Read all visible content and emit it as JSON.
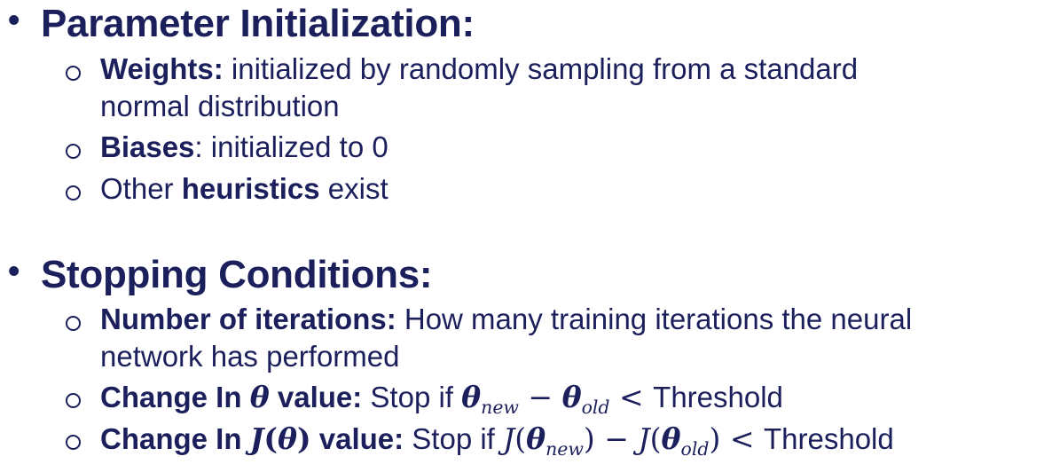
{
  "sections": [
    {
      "heading": "Parameter Initialization:",
      "items": [
        {
          "bold": "Weights:",
          "text": " initialized by randomly sampling from a standard",
          "continuation": "normal distribution"
        },
        {
          "bold": "Biases",
          "text": ": initialized to 0"
        },
        {
          "pre": "Other ",
          "bold": "heuristics",
          "text": " exist"
        }
      ]
    },
    {
      "heading": "Stopping Conditions:",
      "items": [
        {
          "bold": "Number of iterations:",
          "text": " How many training iterations the neural",
          "continuation": "network has performed"
        },
        {
          "bold_pre": "Change In ",
          "bold_symbol": "θ",
          "bold_post": " value:",
          "text": " Stop if ",
          "math": {
            "theta": "θ",
            "new": "new",
            "minus": " − ",
            "old": "old",
            "lt": " < ",
            "threshold": "Threshold"
          }
        },
        {
          "bold_pre": "Change In ",
          "bold_symbol": "J",
          "bold_paren_open": "(",
          "bold_theta": "θ",
          "bold_paren_close": ")",
          "bold_post": " value:",
          "text": " Stop if ",
          "math": {
            "J": "J",
            "open": "(",
            "theta": "θ",
            "new": "new",
            "close": ")",
            "minus": " − ",
            "old": "old",
            "lt": " < ",
            "threshold": "Threshold"
          }
        }
      ]
    }
  ]
}
